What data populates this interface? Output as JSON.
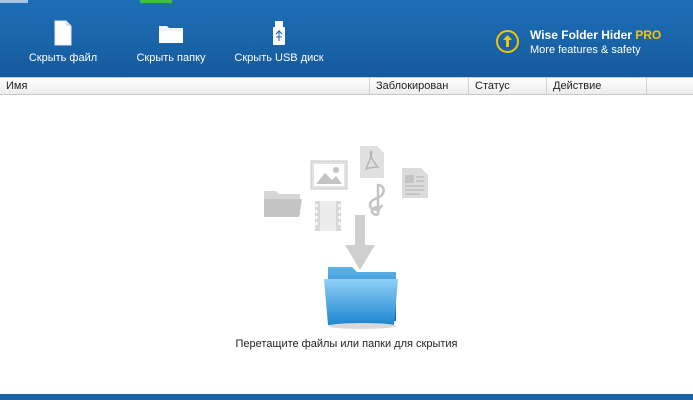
{
  "toolbar": {
    "hide_file_label": "Скрыть файл",
    "hide_folder_label": "Скрыть папку",
    "hide_usb_label": "Скрыть USB диск"
  },
  "promo": {
    "title_main": "Wise Folder Hider ",
    "title_pro": "PRO",
    "subtitle": "More features & safety"
  },
  "columns": {
    "name": "Имя",
    "locked": "Заблокирован",
    "status": "Статус",
    "action": "Действие"
  },
  "empty_state": {
    "drop_text": "Перетащите файлы или папки для скрытия",
    "icons": [
      "folder-icon",
      "image-icon",
      "pdf-icon",
      "document-icon",
      "video-icon",
      "music-icon",
      "arrow-down-icon",
      "blue-folder-icon"
    ]
  },
  "colors": {
    "toolbar_bg": "#1a65ad",
    "accent_pro": "#f5c400"
  }
}
